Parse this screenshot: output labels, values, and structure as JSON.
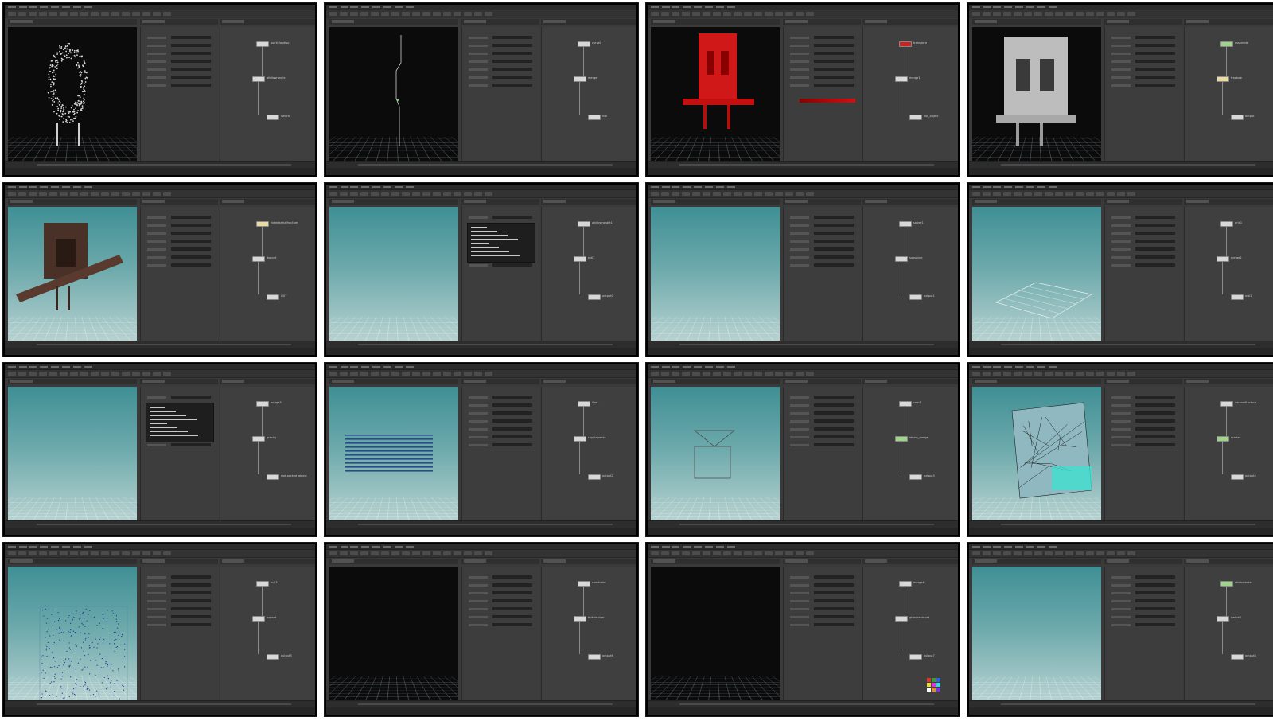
{
  "title": "",
  "tiles": [
    {
      "id": 1,
      "viewport": "dark",
      "model": "point-cloud",
      "nodes": [
        {
          "label": "pointcloudiso",
          "style": "normal"
        },
        {
          "label": "attribwrangle",
          "style": "normal"
        },
        {
          "label": "switch",
          "style": "normal"
        }
      ]
    },
    {
      "id": 2,
      "viewport": "dark",
      "model": "line",
      "nodes": [
        {
          "label": "curve1",
          "style": "normal"
        },
        {
          "label": "merge",
          "style": "normal"
        },
        {
          "label": "null",
          "style": "normal"
        }
      ]
    },
    {
      "id": 3,
      "viewport": "dark",
      "model": "red-model",
      "nodes": [
        {
          "label": "transform",
          "style": "red"
        },
        {
          "label": "merge1",
          "style": "normal"
        },
        {
          "label": "rbd_object",
          "style": "normal"
        }
      ]
    },
    {
      "id": 4,
      "viewport": "dark",
      "model": "white-model",
      "nodes": [
        {
          "label": "assemble",
          "style": "green"
        },
        {
          "label": "fracture",
          "style": "yellow"
        },
        {
          "label": "output",
          "style": "normal"
        }
      ]
    },
    {
      "id": 5,
      "viewport": "teal",
      "model": "brown-model",
      "nodes": [
        {
          "label": "rbdmaterialfracture",
          "style": "yellow"
        },
        {
          "label": "dopnet",
          "style": "normal"
        },
        {
          "label": "OUT",
          "style": "normal"
        }
      ]
    },
    {
      "id": 6,
      "viewport": "teal",
      "model": "empty",
      "nodes": [
        {
          "label": "attribwrangle1",
          "style": "normal"
        },
        {
          "label": "null1",
          "style": "normal"
        },
        {
          "label": "output0",
          "style": "normal"
        }
      ]
    },
    {
      "id": 7,
      "viewport": "teal",
      "model": "empty",
      "nodes": [
        {
          "label": "solver1",
          "style": "normal"
        },
        {
          "label": "sopsolver",
          "style": "normal"
        },
        {
          "label": "output1",
          "style": "normal"
        }
      ]
    },
    {
      "id": 8,
      "viewport": "teal",
      "model": "grid-plane",
      "nodes": [
        {
          "label": "grid1",
          "style": "normal"
        },
        {
          "label": "merge2",
          "style": "normal"
        },
        {
          "label": "null2",
          "style": "normal"
        }
      ]
    },
    {
      "id": 9,
      "viewport": "teal",
      "model": "empty",
      "nodes": [
        {
          "label": "merge3",
          "style": "normal"
        },
        {
          "label": "gravity",
          "style": "normal"
        },
        {
          "label": "rbd_packed_object",
          "style": "normal"
        }
      ]
    },
    {
      "id": 10,
      "viewport": "teal",
      "model": "stripes",
      "nodes": [
        {
          "label": "line1",
          "style": "normal"
        },
        {
          "label": "copytopoints",
          "style": "normal"
        },
        {
          "label": "output2",
          "style": "normal"
        }
      ]
    },
    {
      "id": 11,
      "viewport": "teal",
      "model": "camera",
      "nodes": [
        {
          "label": "cam1",
          "style": "normal"
        },
        {
          "label": "object_merge",
          "style": "green"
        },
        {
          "label": "output3",
          "style": "normal"
        }
      ]
    },
    {
      "id": 12,
      "viewport": "teal",
      "model": "cracked",
      "nodes": [
        {
          "label": "voronoifracture",
          "style": "normal"
        },
        {
          "label": "scatter",
          "style": "green"
        },
        {
          "label": "output4",
          "style": "normal"
        }
      ]
    },
    {
      "id": 13,
      "viewport": "teal",
      "model": "scatter",
      "nodes": [
        {
          "label": "null3",
          "style": "normal"
        },
        {
          "label": "popnet",
          "style": "normal"
        },
        {
          "label": "output5",
          "style": "normal"
        }
      ]
    },
    {
      "id": 14,
      "viewport": "dark",
      "model": "empty",
      "nodes": [
        {
          "label": "constraint",
          "style": "normal"
        },
        {
          "label": "bulletsolver",
          "style": "normal"
        },
        {
          "label": "output6",
          "style": "normal"
        }
      ]
    },
    {
      "id": 15,
      "viewport": "dark",
      "model": "empty",
      "nodes": [
        {
          "label": "merge4",
          "style": "normal"
        },
        {
          "label": "glueconstraint",
          "style": "normal"
        },
        {
          "label": "output7",
          "style": "normal"
        }
      ]
    },
    {
      "id": 16,
      "viewport": "teal",
      "model": "empty",
      "nodes": [
        {
          "label": "attribcreate",
          "style": "green"
        },
        {
          "label": "switch1",
          "style": "normal"
        },
        {
          "label": "output8",
          "style": "normal"
        }
      ]
    }
  ]
}
